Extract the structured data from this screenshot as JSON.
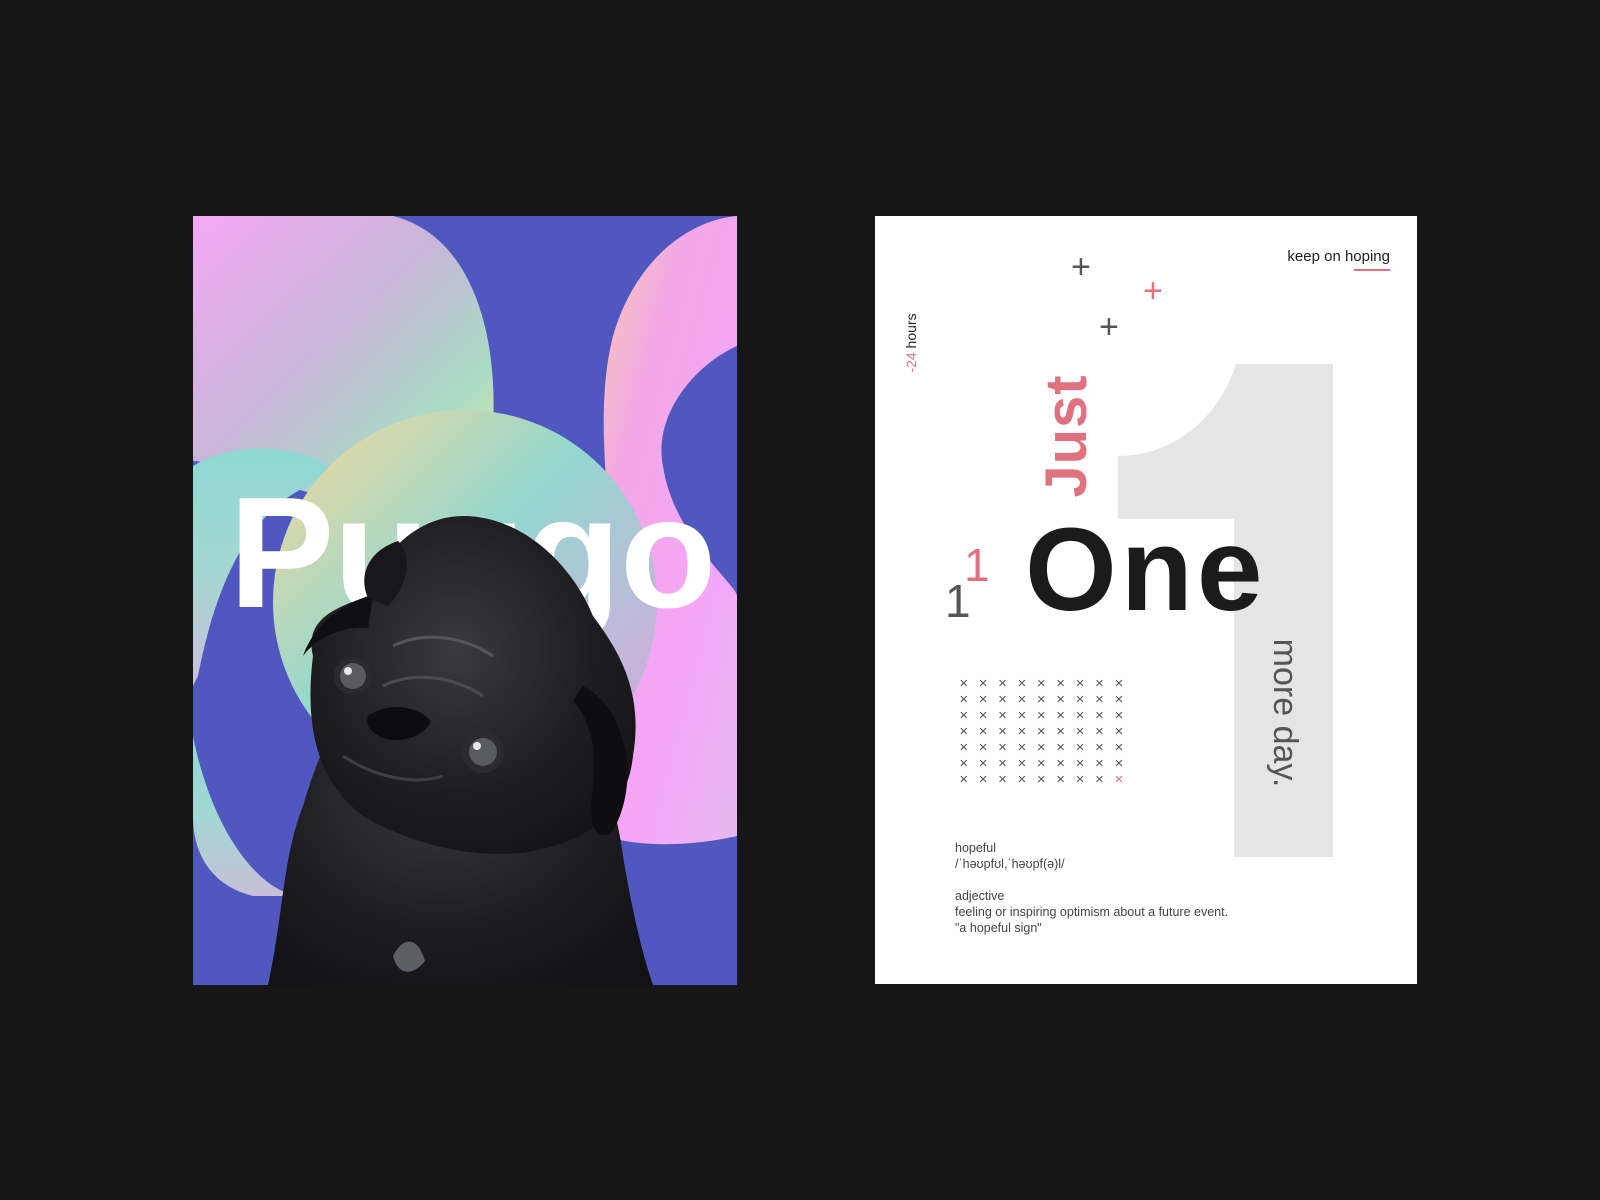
{
  "poster_puggo": {
    "title": "Puggo",
    "colors": {
      "background": "#5058c0",
      "blob_pink": "#f4aaf8",
      "blob_mint": "#8ed8d2",
      "blob_peach": "#f8d8a0"
    }
  },
  "poster_one": {
    "tagline": "keep on hoping",
    "hours_prefix": "-24",
    "hours_word": "hours",
    "just": "Just",
    "one": "One",
    "small_one_a": "1",
    "small_one_b": "1",
    "more_day": "more day.",
    "big_numeral": "1",
    "grid": {
      "rows": 7,
      "cols": 9,
      "symbol": "×",
      "highlight": "last"
    },
    "definition": {
      "word": "hopeful",
      "pronunciation": "/ˈhəʊpfʊl,ˈhəʊpf(ə)l/",
      "part_of_speech": "adjective",
      "meaning": "feeling or inspiring optimism about a future event.",
      "example": "\"a hopeful sign\""
    },
    "colors": {
      "accent": "#e0717f",
      "dark": "#1b1b1b",
      "numeral_gray": "#e5e5e5"
    }
  }
}
